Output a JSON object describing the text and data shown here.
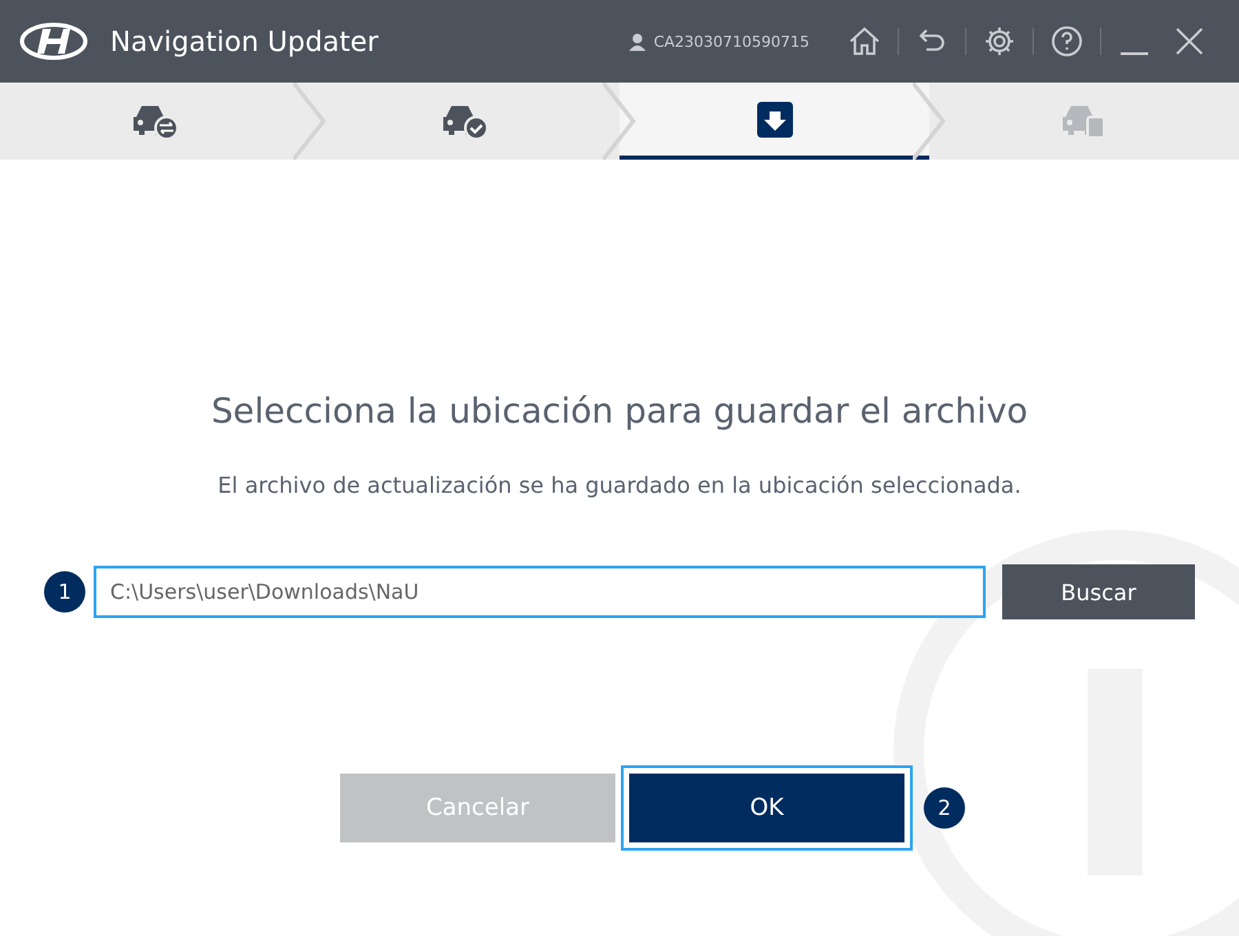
{
  "window": {
    "title": "Navigation Updater",
    "user_id": "CA23030710590715"
  },
  "steps": [
    {
      "kind": "car-swap",
      "selected": false,
      "disabled": false
    },
    {
      "kind": "car-check",
      "selected": false,
      "disabled": false
    },
    {
      "kind": "download",
      "selected": true,
      "disabled": false
    },
    {
      "kind": "car-sd",
      "selected": false,
      "disabled": true
    }
  ],
  "dialog": {
    "title": "Selecciona la ubicación para guardar el archivo",
    "message": "El archivo de actualización se ha guardado en la ubicación seleccionada.",
    "path_marker": "1",
    "path_value": "C:\\Users\\user\\Downloads\\NaU",
    "browse_button": "Buscar",
    "cancel_button": "Cancelar",
    "ok_button": "OK",
    "ok_marker": "2"
  }
}
